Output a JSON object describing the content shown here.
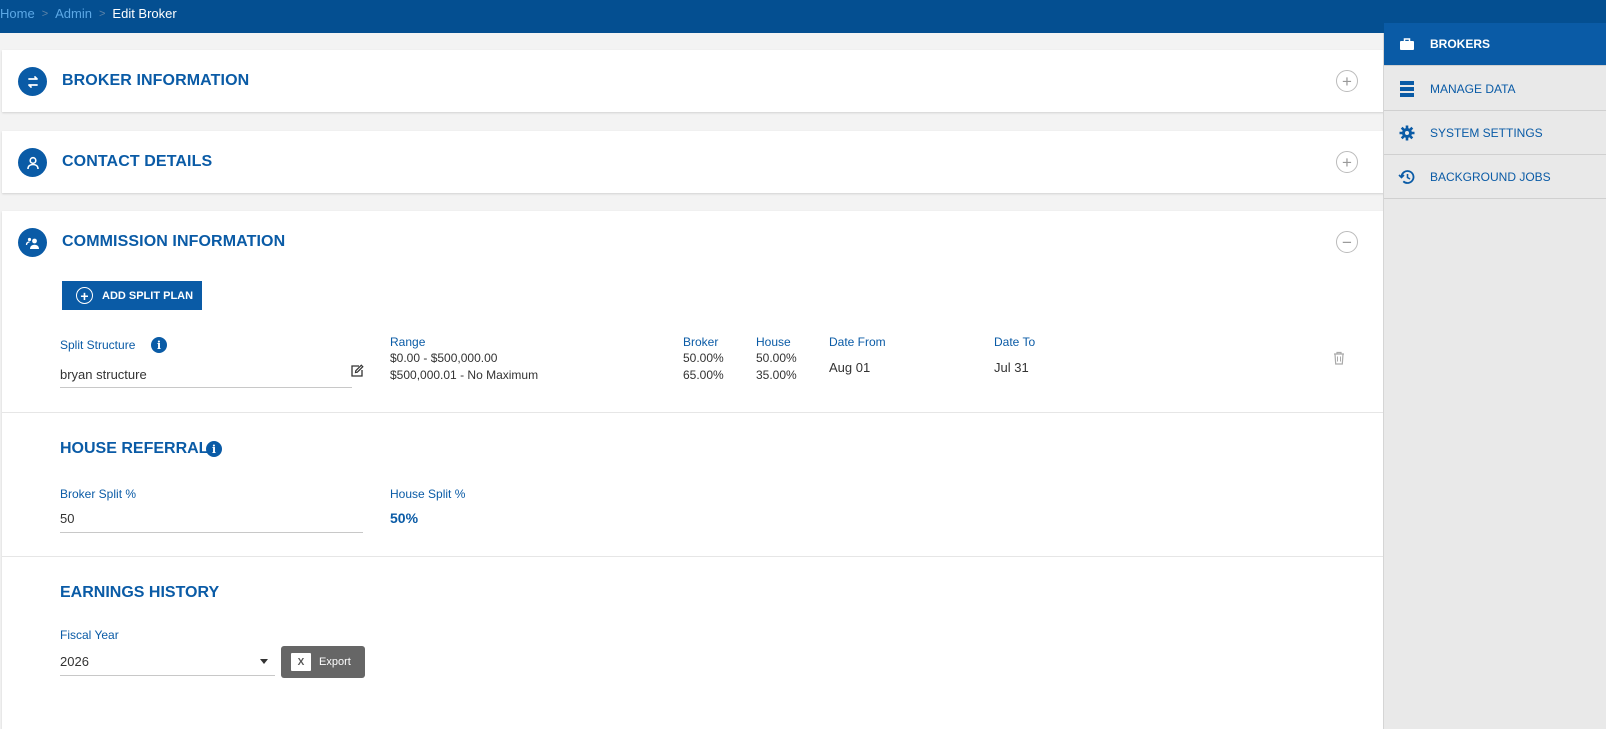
{
  "breadcrumb": {
    "home": "Home",
    "admin": "Admin",
    "current": "Edit Broker"
  },
  "panels": {
    "broker_info": {
      "title": "BROKER INFORMATION",
      "toggle": "+"
    },
    "contact_details": {
      "title": "CONTACT DETAILS",
      "toggle": "+"
    },
    "commission": {
      "title": "COMMISSION INFORMATION",
      "toggle": "−"
    }
  },
  "commission": {
    "add_split_label": "ADD SPLIT PLAN",
    "split_structure_label": "Split Structure",
    "split_structure_value": "bryan structure",
    "range_header": "Range",
    "broker_header": "Broker",
    "house_header": "House",
    "date_from_header": "Date From",
    "date_to_header": "Date To",
    "rows": [
      {
        "range": "$0.00 - $500,000.00",
        "broker": "50.00%",
        "house": "50.00%"
      },
      {
        "range": "$500,000.01 - No Maximum",
        "broker": "65.00%",
        "house": "35.00%"
      }
    ],
    "date_from": "Aug 01",
    "date_to": "Jul 31"
  },
  "house_referral": {
    "title": "HOUSE REFERRAL",
    "broker_split_label": "Broker Split %",
    "broker_split_value": "50",
    "house_split_label": "House Split %",
    "house_split_value": "50%"
  },
  "earnings": {
    "title": "EARNINGS HISTORY",
    "fiscal_year_label": "Fiscal Year",
    "fiscal_year_value": "2026",
    "export_label": "Export"
  },
  "sidebar": {
    "items": [
      {
        "label": "BROKERS",
        "icon": "briefcase-icon",
        "active": true
      },
      {
        "label": "MANAGE DATA",
        "icon": "database-icon",
        "active": false
      },
      {
        "label": "SYSTEM SETTINGS",
        "icon": "gear-icon",
        "active": false
      },
      {
        "label": "BACKGROUND JOBS",
        "icon": "history-icon",
        "active": false
      }
    ]
  },
  "colors": {
    "topbar": "#044f91",
    "accent": "#0a5ba6",
    "export_button": "#666666"
  }
}
